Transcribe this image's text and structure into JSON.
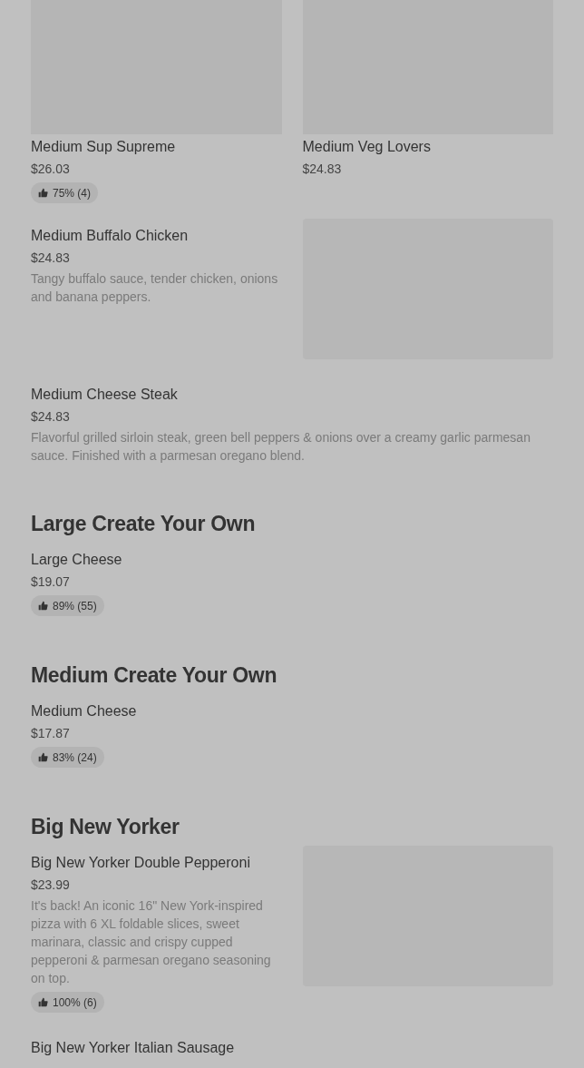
{
  "tiles": [
    {
      "name": "Medium Sup Supreme",
      "price": "$26.03",
      "rating": "75% (4)",
      "image": true
    },
    {
      "name": "Medium Veg Lovers",
      "price": "$24.83",
      "image": true
    }
  ],
  "sections": [
    {
      "items": [
        {
          "name": "Medium Buffalo Chicken",
          "price": "$24.83",
          "description": "Tangy buffalo sauce, tender chicken, onions and banana peppers.",
          "image": true
        },
        {
          "name": "Medium Cheese Steak",
          "price": "$24.83",
          "description": "Flavorful grilled sirloin steak, green bell peppers & onions over a creamy garlic parmesan sauce. Finished with a parmesan oregano blend.",
          "image": false
        }
      ]
    },
    {
      "heading": "Large Create Your Own",
      "items": [
        {
          "name": "Large Cheese",
          "price": "$19.07",
          "rating": "89% (55)",
          "image": false
        }
      ]
    },
    {
      "heading": "Medium Create Your Own",
      "items": [
        {
          "name": "Medium Cheese",
          "price": "$17.87",
          "rating": "83% (24)",
          "image": false
        }
      ]
    },
    {
      "heading": "Big New Yorker",
      "items": [
        {
          "name": "Big New Yorker Double Pepperoni",
          "price": "$23.99",
          "description": "It's back! An iconic 16\" New York-inspired pizza with 6 XL foldable slices, sweet marinara, classic and crispy cupped pepperoni & parmesan oregano seasoning on top.",
          "rating": "100% (6)",
          "image": true
        },
        {
          "name": "Big New Yorker Italian Sausage",
          "image": false
        }
      ]
    }
  ]
}
